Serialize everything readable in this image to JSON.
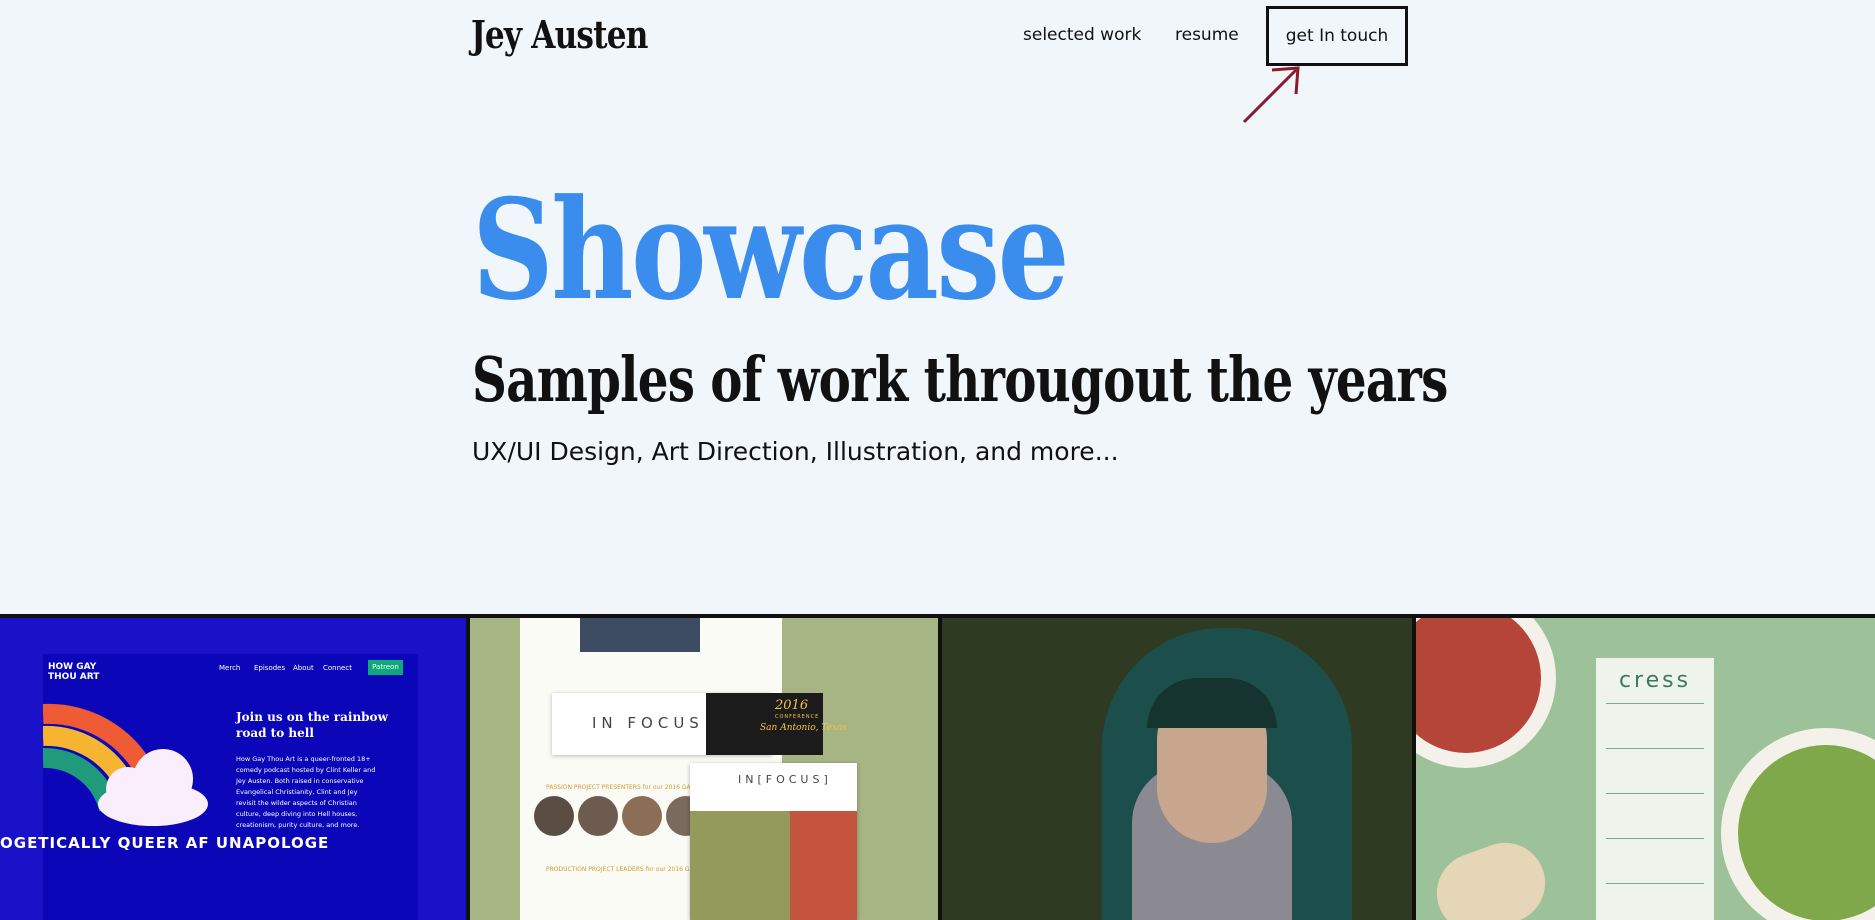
{
  "header": {
    "logo": "Jey Austen",
    "nav": {
      "selected_work": "selected work",
      "resume": "resume",
      "get_in_touch": "get In touch"
    }
  },
  "hero": {
    "title": "Showcase",
    "subtitle": "Samples of work througout the years",
    "description": "UX/UI Design, Art Direction, Illustration, and more..."
  },
  "colors": {
    "background": "#f1f6fa",
    "title_blue": "#3a8ded",
    "arrow": "#8b1a2b"
  },
  "gallery": {
    "tile1": {
      "brand": "HOW GAY THOU ART",
      "nav": [
        "Merch",
        "Episodes",
        "About",
        "Connect"
      ],
      "patreon": "Patreon",
      "headline": "Join us on the rainbow road to hell",
      "body": "How Gay Thou Art is a queer-fronted 18+ comedy podcast hosted by Clint Keller and Jey Austen. Both raised in conservative Evangelical Christianity, Clint and Jey revisit the wilder aspects of Christian culture, deep diving into Hell houses, creationism, purity culture, and more.",
      "marquee": "OGETICALLY QUEER AF  UNAPOLOGE"
    },
    "tile2": {
      "brand": "IN FOCUS",
      "brand_card": "IN[FOCUS]",
      "year": "2016",
      "conference": "CONFERENCE",
      "location": "San Antonio, Texas",
      "presenters_label": "PASSION PROJECT PRESENTERS for our 2016 GATHERING",
      "leaders_label": "PRODUCTION PROJECT LEADERS for our 2016 GATHERING"
    },
    "tile4": {
      "brand": "cress"
    }
  }
}
